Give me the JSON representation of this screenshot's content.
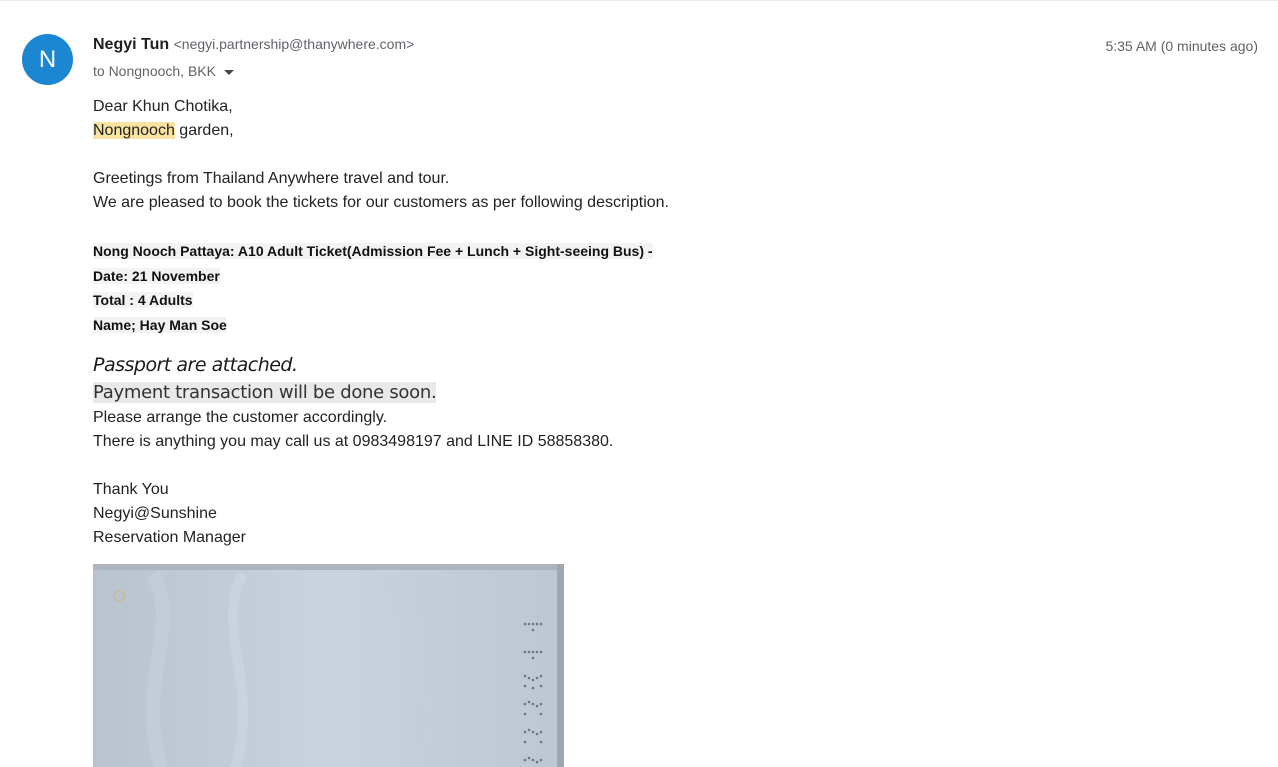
{
  "sender": {
    "initial": "N",
    "name": "Negyi Tun",
    "email": "<negyi.partnership@thanywhere.com>",
    "recipients": "to Nongnooch, BKK",
    "timestamp": "5:35 AM (0 minutes ago)",
    "avatar_color": "#1b86d1"
  },
  "body": {
    "greeting": "Dear Khun Chotika,",
    "place_highlight": "Nongnooch",
    "place_rest": " garden,",
    "intro1": "Greetings from Thailand Anywhere travel and tour.",
    "intro2": "We are pleased to book the tickets for our customers as per following description.",
    "ticket": "Nong Nooch Pattaya: A10 Adult Ticket(Admission Fee + Lunch + Sight-seeing Bus) -",
    "date": "Date: 21 November",
    "total": "Total : 4 Adults",
    "name": "Name; Hay Man Soe",
    "passport": "Passport are attached.",
    "payment": "Payment transaction will be done soon.",
    "arrange": "Please arrange the customer accordingly.",
    "contact": "There is anything you may call us at 0983498197 and LINE ID 58858380.",
    "thanks": "Thank You",
    "signature": "Negyi@Sunshine",
    "title": "Reservation Manager"
  },
  "attachment": {
    "icon": "passport-scan-image",
    "number": "2325 11"
  }
}
